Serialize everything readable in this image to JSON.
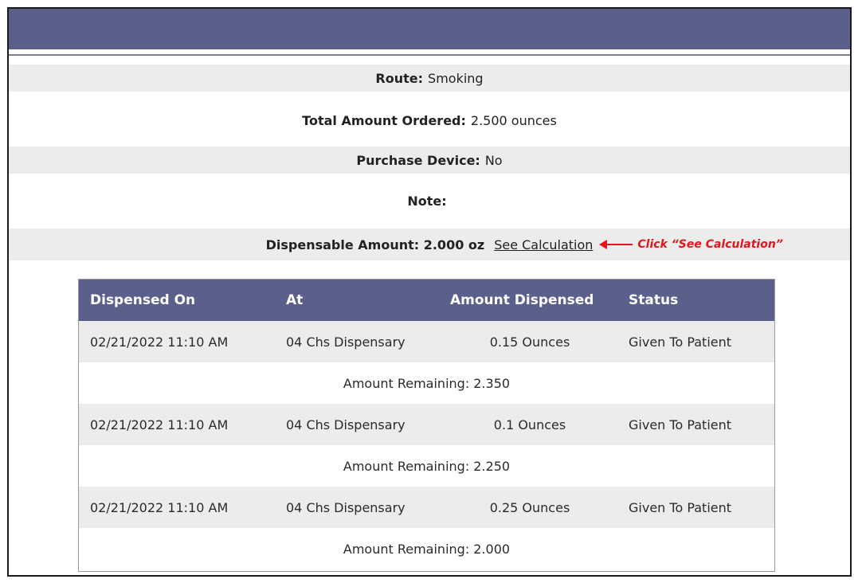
{
  "details": {
    "route_label": "Route:",
    "route_value": "Smoking",
    "total_label": "Total Amount Ordered:",
    "total_value": "2.500 ounces",
    "device_label": "Purchase Device:",
    "device_value": "No",
    "note_label": "Note:",
    "note_value": "",
    "dispensable_label": "Dispensable Amount: 2.000 oz",
    "see_calculation": "See Calculation",
    "callout": "Click “See Calculation”"
  },
  "colors": {
    "header_bar": "#5b5f8c",
    "callout_red": "#e0161b",
    "row_shade": "#ececec"
  },
  "table": {
    "headers": [
      "Dispensed On",
      "At",
      "Amount Dispensed",
      "Status"
    ],
    "rows": [
      {
        "dispensed_on": "02/21/2022 11:10 AM",
        "at": "04 Chs Dispensary",
        "amount": "0.15 Ounces",
        "status": "Given To Patient",
        "remaining": "Amount Remaining: 2.350"
      },
      {
        "dispensed_on": "02/21/2022 11:10 AM",
        "at": "04 Chs Dispensary",
        "amount": "0.1 Ounces",
        "status": "Given To Patient",
        "remaining": "Amount Remaining: 2.250"
      },
      {
        "dispensed_on": "02/21/2022 11:10 AM",
        "at": "04 Chs Dispensary",
        "amount": "0.25 Ounces",
        "status": "Given To Patient",
        "remaining": "Amount Remaining: 2.000"
      }
    ]
  }
}
